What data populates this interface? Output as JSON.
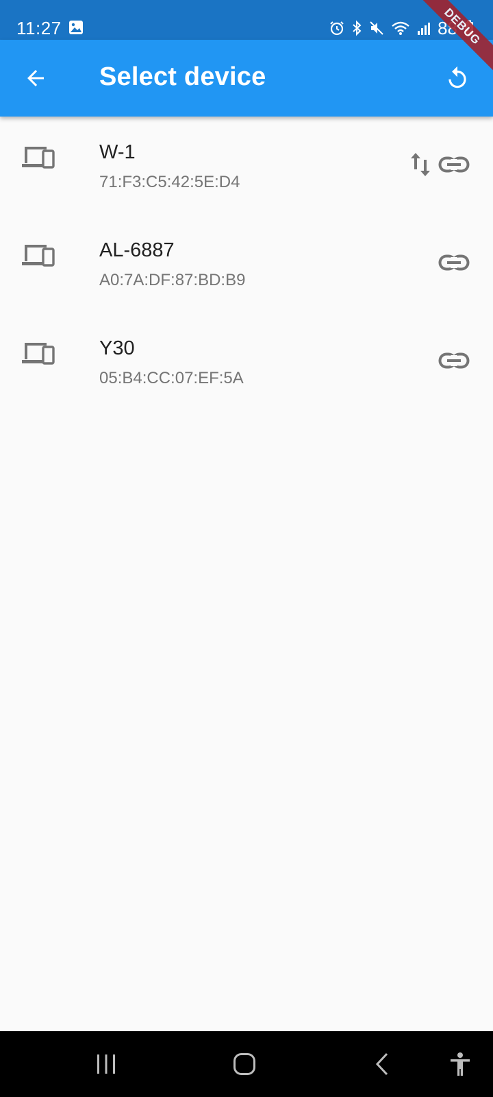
{
  "status_bar": {
    "time": "11:27",
    "battery": "88",
    "icons": [
      "gallery-icon",
      "alarm-icon",
      "bluetooth-icon",
      "mute-icon",
      "wifi-icon",
      "signal-icon",
      "battery-charging-icon"
    ]
  },
  "debug_banner": {
    "label": "DEBUG"
  },
  "app_bar": {
    "title": "Select device",
    "back_icon": "arrow-back-icon",
    "refresh_icon": "refresh-icon",
    "color": "#2196f3"
  },
  "devices": [
    {
      "name": "W-1",
      "mac": "71:F3:C5:42:5E:D4",
      "icon": "devices-icon",
      "actions": [
        "swap-vert-icon",
        "link-icon"
      ]
    },
    {
      "name": "AL-6887",
      "mac": "A0:7A:DF:87:BD:B9",
      "icon": "devices-icon",
      "actions": [
        "link-icon"
      ]
    },
    {
      "name": "Y30",
      "mac": "05:B4:CC:07:EF:5A",
      "icon": "devices-icon",
      "actions": [
        "link-icon"
      ]
    }
  ],
  "nav_bar": {
    "buttons": [
      "recent-apps-icon",
      "home-icon",
      "back-nav-icon",
      "accessibility-icon"
    ]
  }
}
